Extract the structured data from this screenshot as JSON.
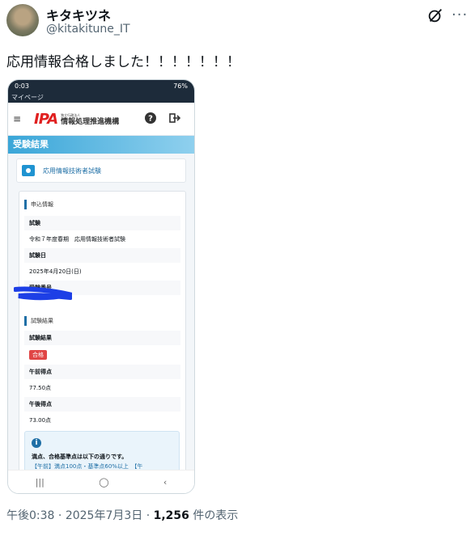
{
  "author": {
    "name": "キタキツネ",
    "handle": "@kitakitune_IT"
  },
  "tweet": {
    "text": "応用情報合格しました！！！！！！！"
  },
  "phone": {
    "status_time": "0:03",
    "status_battery": "76%",
    "tab_title": "マイページ",
    "org_name": "情報処理推進機構",
    "org_small": "独立行政法人",
    "logo_text": "IPA",
    "section_title": "受験結果",
    "exam_name": "応用情報技術者試験",
    "application": {
      "heading": "申込情報",
      "exam_label": "試験",
      "exam_value": "令和７年度春期　応用情報技術者試験",
      "date_label": "試験日",
      "date_value": "2025年4月20日(日)",
      "number_label": "受験番号"
    },
    "result": {
      "heading": "試験結果",
      "result_label": "試験結果",
      "result_badge": "合格",
      "am_label": "午前得点",
      "am_value": "77.50点",
      "pm_label": "午後得点",
      "pm_value": "73.00点"
    },
    "info": {
      "line1": "満点、合格基準点は以下の通りです。",
      "line2": "【午前】満点100点・基準点60%以上　【午"
    },
    "nav": {
      "recent": "|||",
      "home": "◯",
      "back": "‹"
    }
  },
  "meta": {
    "time": "午後0:38",
    "date": "2025年7月3日",
    "views": "1,256",
    "views_suffix": "件の表示"
  },
  "colors": {
    "accent": "#1f6fa6",
    "pass_badge": "#e04545",
    "ipa_red": "#e02020"
  }
}
